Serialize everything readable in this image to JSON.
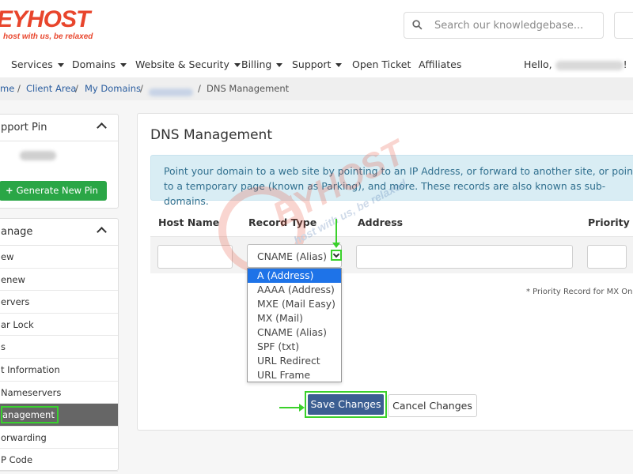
{
  "brand": {
    "logo_text": "EYHOST",
    "tagline": "host with us, be relaxed",
    "color": "#e8452c"
  },
  "search": {
    "placeholder": "Search our knowledgebase..."
  },
  "nav": {
    "items": [
      "Services",
      "Domains",
      "Website & Security",
      "Billing",
      "Support",
      "Open Ticket",
      "Affiliates"
    ],
    "hello": "Hello,",
    "hello_suffix": "!"
  },
  "breadcrumb": {
    "home": "me",
    "client_area": "Client Area",
    "my_domains": "My Domains",
    "current": "DNS Management",
    "sep": "/"
  },
  "sidebar": {
    "support_pin": {
      "title": "pport Pin",
      "button": "Generate New Pin",
      "plus": "+"
    },
    "manage": {
      "title": "anage",
      "items": [
        "ew",
        "enew",
        "ervers",
        "ar Lock",
        "s",
        "t Information",
        "Nameservers",
        "anagement",
        "orwarding",
        "P Code"
      ],
      "active_index": 7
    }
  },
  "main": {
    "title": "DNS Management",
    "alert": "Point your domain to a web site by pointing to an IP Address, or forward to another site, or point to a temporary page (known as Parking), and more. These records are also known as sub-domains.",
    "columns": {
      "host": "Host Name",
      "type": "Record Type",
      "address": "Address",
      "priority": "Priority"
    },
    "record_type_selected": "CNAME (Alias)",
    "record_type_options": [
      "A (Address)",
      "AAAA (Address)",
      "MXE (Mail Easy)",
      "MX (Mail)",
      "CNAME (Alias)",
      "SPF (txt)",
      "URL Redirect",
      "URL Frame"
    ],
    "highlighted_option_index": 0,
    "priority_note": "* Priority Record for MX Only",
    "save_label": "Save Changes",
    "cancel_label": "Cancel Changes"
  },
  "colors": {
    "accent_green": "#2aa646",
    "highlight_green": "#3ad12a",
    "save_blue": "#3b5e92",
    "alert_bg": "#d9edf4",
    "alert_text": "#31708f",
    "selected_option": "#1e73e8"
  }
}
